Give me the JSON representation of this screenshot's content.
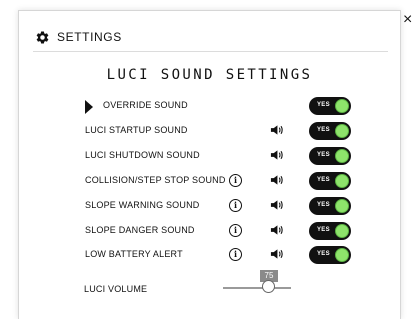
{
  "header": {
    "title": "SETTINGS",
    "icon": "gear-icon"
  },
  "section_title": "LUCI SOUND SETTINGS",
  "override": {
    "label": "OVERRIDE SOUND",
    "toggle_label": "YES",
    "on": true
  },
  "rows": [
    {
      "label": "LUCI STARTUP SOUND",
      "info": false,
      "toggle_label": "YES",
      "on": true
    },
    {
      "label": "LUCI SHUTDOWN SOUND",
      "info": false,
      "toggle_label": "YES",
      "on": true
    },
    {
      "label": "COLLISION/STEP STOP SOUND",
      "info": true,
      "toggle_label": "YES",
      "on": true
    },
    {
      "label": "SLOPE WARNING SOUND",
      "info": true,
      "toggle_label": "YES",
      "on": true
    },
    {
      "label": "SLOPE DANGER SOUND",
      "info": true,
      "toggle_label": "YES",
      "on": true
    },
    {
      "label": "LOW BATTERY ALERT",
      "info": true,
      "toggle_label": "YES",
      "on": true
    }
  ],
  "volume": {
    "label": "LUCI VOLUME",
    "value": "75",
    "fraction": 0.75
  },
  "colors": {
    "toggle_bg": "#111111",
    "knob": "#8ee36b"
  },
  "close_symbol": "×"
}
